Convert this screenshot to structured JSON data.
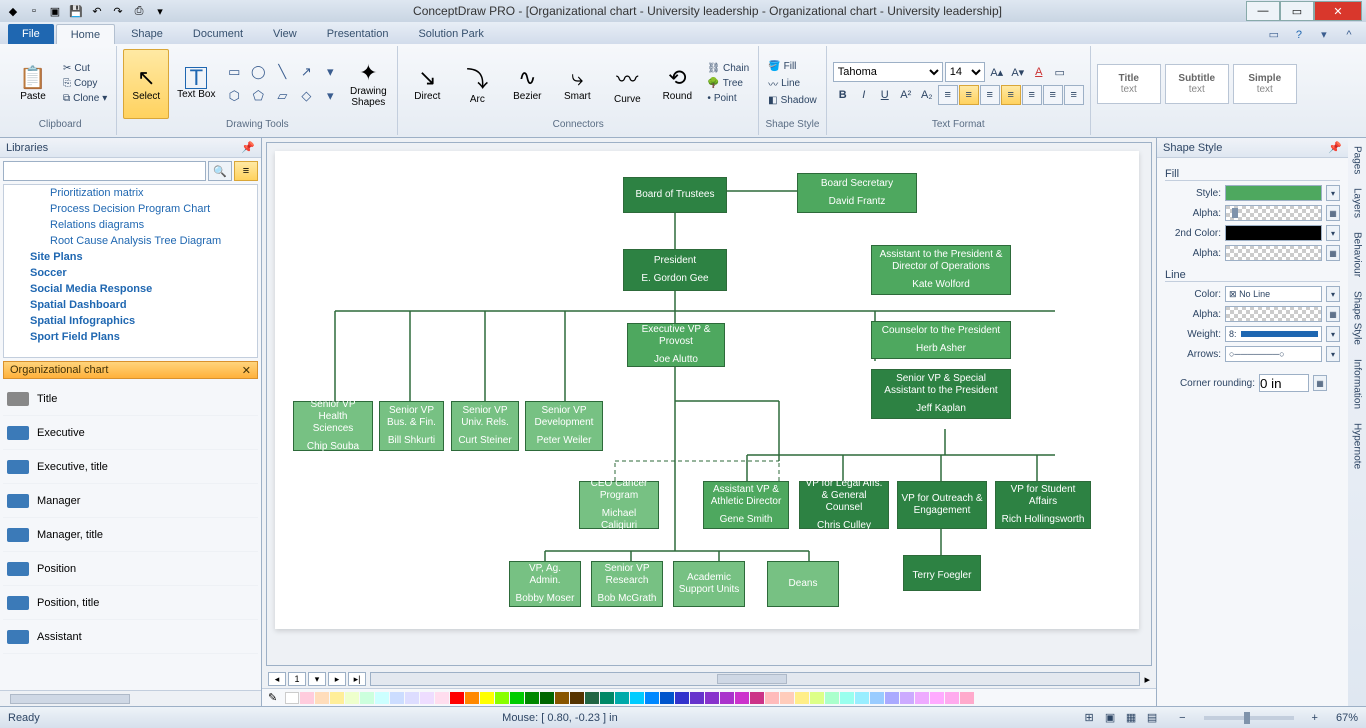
{
  "app_title": "ConceptDraw PRO - [Organizational chart - University leadership - Organizational chart - University leadership]",
  "tabs": {
    "file": "File",
    "home": "Home",
    "shape": "Shape",
    "document": "Document",
    "view": "View",
    "presentation": "Presentation",
    "solution": "Solution Park"
  },
  "ribbon": {
    "clipboard": {
      "paste": "Paste",
      "cut": "Cut",
      "copy": "Copy",
      "clone": "Clone",
      "label": "Clipboard"
    },
    "select": "Select",
    "textbox": "Text Box",
    "drawing_shapes": "Drawing Shapes",
    "drawing_tools_label": "Drawing Tools",
    "connectors": {
      "direct": "Direct",
      "arc": "Arc",
      "bezier": "Bezier",
      "smart": "Smart",
      "curve": "Curve",
      "round": "Round",
      "chain": "Chain",
      "tree": "Tree",
      "point": "Point",
      "label": "Connectors"
    },
    "shape_style": {
      "fill": "Fill",
      "line": "Line",
      "shadow": "Shadow",
      "label": "Shape Style"
    },
    "text_format": {
      "font": "Tahoma",
      "size": "14",
      "label": "Text Format"
    },
    "styles": {
      "t1": "Title",
      "s1": "text",
      "t2": "Subtitle",
      "s2": "text",
      "t3": "Simple",
      "s3": "text"
    }
  },
  "libraries": {
    "header": "Libraries",
    "items": [
      "Prioritization matrix",
      "Process Decision Program Chart",
      "Relations diagrams",
      "Root Cause Analysis Tree Diagram"
    ],
    "cats": [
      "Site Plans",
      "Soccer",
      "Social Media Response",
      "Spatial Dashboard",
      "Spatial Infographics",
      "Sport Field Plans"
    ],
    "stencil_header": "Organizational chart",
    "stencils": [
      "Title",
      "Executive",
      "Executive, title",
      "Manager",
      "Manager, title",
      "Position",
      "Position, title",
      "Assistant"
    ]
  },
  "shape_style_panel": {
    "header": "Shape Style",
    "fill": "Fill",
    "style": "Style:",
    "alpha": "Alpha:",
    "second": "2nd Color:",
    "line": "Line",
    "color": "Color:",
    "noline": "No Line",
    "weight": "Weight:",
    "weight_val": "8:",
    "arrows": "Arrows:",
    "rounding": "Corner rounding:",
    "rounding_val": "0 in",
    "tabs": [
      "Pages",
      "Layers",
      "Behaviour",
      "Shape Style",
      "Information",
      "Hypernote"
    ]
  },
  "chart": {
    "board_trustees": {
      "t": "Board of Trustees"
    },
    "board_secretary": {
      "t": "Board Secretary",
      "n": "David Frantz"
    },
    "president": {
      "t": "President",
      "n": "E. Gordon Gee"
    },
    "assistant_ops": {
      "t": "Assistant to the President & Director of Operations",
      "n": "Kate Wolford"
    },
    "provost": {
      "t": "Executive VP & Provost",
      "n": "Joe Alutto"
    },
    "counselor": {
      "t": "Counselor to the President",
      "n": "Herb Asher"
    },
    "senior_special": {
      "t": "Senior VP & Special Assistant to the President",
      "n": "Jeff Kaplan"
    },
    "health": {
      "t": "Senior VP Health Sciences",
      "n": "Chip Souba"
    },
    "busfin": {
      "t": "Senior VP Bus. & Fin.",
      "n": "Bill Shkurti"
    },
    "univrels": {
      "t": "Senior VP Univ. Rels.",
      "n": "Curt Steiner"
    },
    "dev": {
      "t": "Senior VP Development",
      "n": "Peter Weiler"
    },
    "cancer": {
      "t": "CEO Cancer Program",
      "n": "Michael Caligiuri"
    },
    "athletics": {
      "t": "Assistant VP & Athletic Director",
      "n": "Gene Smith"
    },
    "legal": {
      "t": "VP for Legal Affs. & General Counsel",
      "n": "Chris Culley"
    },
    "outreach": {
      "t": "VP for Outreach & Engagement"
    },
    "student": {
      "t": "VP for Student Affairs",
      "n": "Rich Hollingsworth"
    },
    "agadmin": {
      "t": "VP, Ag. Admin.",
      "n": "Bobby Moser"
    },
    "research": {
      "t": "Senior VP Research",
      "n": "Bob McGrath"
    },
    "support": {
      "t": "Academic Support Units"
    },
    "deans": {
      "t": "Deans"
    },
    "foegler": {
      "n": "Terry Foegler"
    }
  },
  "status": {
    "ready": "Ready",
    "mouse": "Mouse: [ 0.80, -0.23 ] in",
    "zoom": "67%"
  }
}
